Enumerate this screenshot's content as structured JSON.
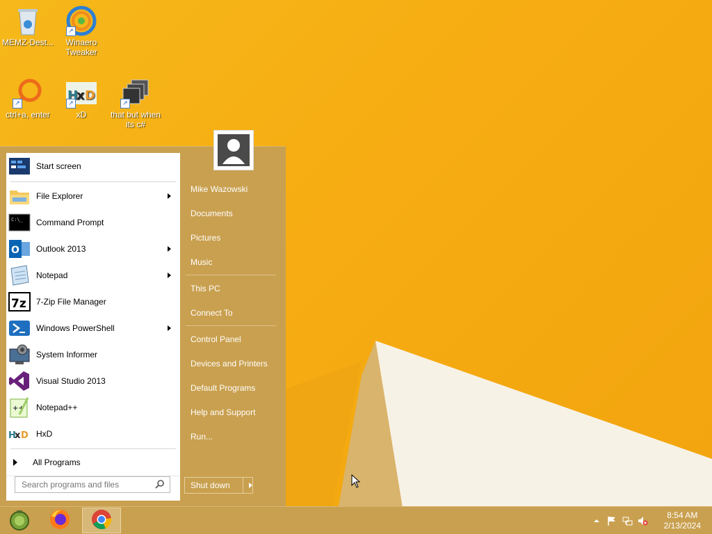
{
  "desktop": {
    "icons": [
      {
        "label": "MEMZ-Dest...",
        "icon": "recycle-bin-icon"
      },
      {
        "label": "Winaero Tweaker",
        "icon": "winaero-tweaker-icon"
      },
      {
        "label": "ctrl+a, enter",
        "icon": "magnifier-ring-icon"
      },
      {
        "label": "xD",
        "icon": "hxd-icon"
      },
      {
        "label": "that but when its c#",
        "icon": "stacked-windows-icon"
      }
    ]
  },
  "start_menu": {
    "pinned": [
      {
        "label": "Start screen",
        "icon": "start-screen-icon",
        "submenu": false
      }
    ],
    "programs": [
      {
        "label": "File Explorer",
        "icon": "folder-icon",
        "submenu": true
      },
      {
        "label": "Command Prompt",
        "icon": "command-prompt-icon",
        "submenu": false
      },
      {
        "label": "Outlook 2013",
        "icon": "outlook-icon",
        "submenu": true
      },
      {
        "label": "Notepad",
        "icon": "notepad-icon",
        "submenu": true
      },
      {
        "label": "7-Zip File Manager",
        "icon": "7zip-icon",
        "submenu": false
      },
      {
        "label": "Windows PowerShell",
        "icon": "powershell-icon",
        "submenu": true
      },
      {
        "label": "System Informer",
        "icon": "system-informer-icon",
        "submenu": false
      },
      {
        "label": "Visual Studio 2013",
        "icon": "visual-studio-icon",
        "submenu": false
      },
      {
        "label": "Notepad++",
        "icon": "notepadpp-icon",
        "submenu": false
      },
      {
        "label": "HxD",
        "icon": "hxd-icon",
        "submenu": false
      }
    ],
    "all_programs": "All Programs",
    "search_placeholder": "Search programs and files",
    "user": {
      "name": "Mike Wazowski",
      "avatar": "user-avatar-icon"
    },
    "right_links": {
      "documents": "Documents",
      "pictures": "Pictures",
      "music": "Music",
      "this_pc": "This PC",
      "connect_to": "Connect To",
      "control_panel": "Control Panel",
      "devices": "Devices and Printers",
      "default_programs": "Default Programs",
      "help": "Help and Support",
      "run": "Run..."
    },
    "shutdown_label": "Shut down"
  },
  "taskbar": {
    "buttons": [
      {
        "name": "start-orb",
        "icon": "start-orb-icon"
      },
      {
        "name": "firefox",
        "icon": "firefox-icon"
      },
      {
        "name": "chrome",
        "icon": "chrome-icon",
        "active": true
      }
    ],
    "tray_icons": [
      "chevron-up-icon",
      "flag-icon",
      "network-icon",
      "speaker-muted-icon"
    ],
    "time": "8:54 AM",
    "date": "2/13/2024"
  },
  "colors": {
    "wallpaper": "#f6b81a",
    "start_menu_bg": "#c9a04f",
    "accent_text": "#ffffff"
  }
}
